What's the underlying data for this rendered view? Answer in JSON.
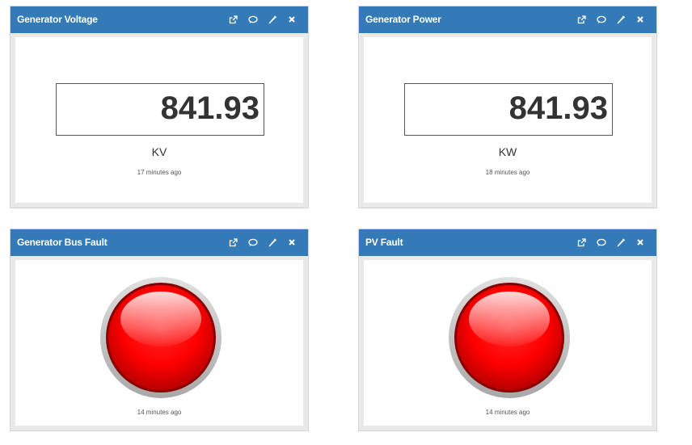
{
  "widgets": [
    {
      "title": "Generator Voltage",
      "value": "841.93",
      "unit": "KV",
      "updated": "17 minutes ago"
    },
    {
      "title": "Generator Power",
      "value": "841.93",
      "unit": "KW",
      "updated": "18 minutes ago"
    },
    {
      "title": "Generator Bus Fault",
      "led_color": "#ff0000",
      "updated": "14 minutes ago"
    },
    {
      "title": "PV Fault",
      "led_color": "#ff0000",
      "updated": "14 minutes ago"
    }
  ],
  "icons": [
    "external-link-icon",
    "comment-icon",
    "pencil-icon",
    "close-icon"
  ],
  "colors": {
    "header": "#337ab7",
    "led": "#ff0000"
  }
}
